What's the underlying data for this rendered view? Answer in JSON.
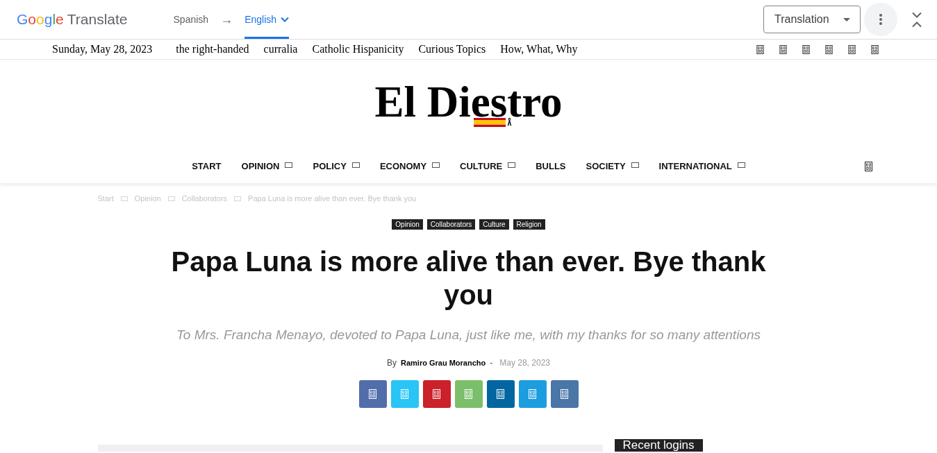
{
  "translate_bar": {
    "brand": "Google",
    "product": "Translate",
    "source_language": {
      "label": "Spanish",
      "selected": false
    },
    "arrow": "→",
    "target_language": {
      "label": "English",
      "selected": true
    },
    "mode_select": {
      "value": "Translation"
    }
  },
  "top_bar": {
    "date": "Sunday, May 28, 2023",
    "links": [
      "the right-handed",
      "curralia",
      "Catholic Hispanicity",
      "Curious Topics",
      "How, What, Why"
    ]
  },
  "masthead": {
    "logo": "El Diestro"
  },
  "nav": {
    "items": [
      {
        "label": "START",
        "has_submenu": false
      },
      {
        "label": "OPINION",
        "has_submenu": true
      },
      {
        "label": "POLICY",
        "has_submenu": true
      },
      {
        "label": "ECONOMY",
        "has_submenu": true
      },
      {
        "label": "CULTURE",
        "has_submenu": true
      },
      {
        "label": "BULLS",
        "has_submenu": false
      },
      {
        "label": "SOCIETY",
        "has_submenu": true
      },
      {
        "label": "INTERNATIONAL",
        "has_submenu": true
      }
    ]
  },
  "breadcrumbs": [
    "Start",
    "Opinion",
    "Collaborators",
    "Papa Luna is more alive than ever. Bye thank you"
  ],
  "article": {
    "tags": [
      "Opinion",
      "Collaborators",
      "Culture",
      "Religion"
    ],
    "title": "Papa Luna is more alive than ever. Bye thank you",
    "subtitle": "To Mrs. Francha Menayo, devoted to Papa Luna, just like me, with my thanks for so many attentions",
    "byline": {
      "prefix": "By",
      "author": "Ramiro Grau Morancho",
      "separator": "-",
      "date": "May 28, 2023"
    },
    "share_buttons": [
      {
        "color": "#516eab"
      },
      {
        "color": "#29c5f6"
      },
      {
        "color": "#ca212a"
      },
      {
        "color": "#7bbf6a"
      },
      {
        "color": "#0266a0"
      },
      {
        "color": "#1c9de0"
      },
      {
        "color": "#4a76a8"
      }
    ]
  },
  "sidebar": {
    "heading": "Recent logins"
  }
}
